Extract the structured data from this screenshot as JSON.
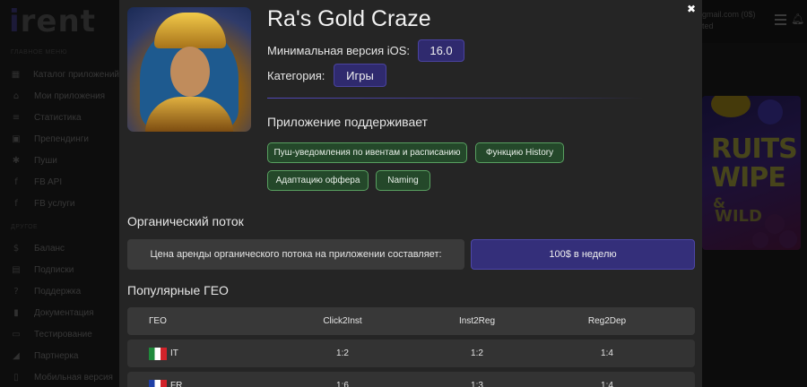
{
  "background": {
    "logo": {
      "accent": "i",
      "rest": "rent"
    },
    "menu_heading_main": "ГЛАВНОЕ МЕНЮ",
    "menu_heading_other": "ДРУГОЕ",
    "menu_items": [
      {
        "icon": "grid-icon",
        "label": "Каталог приложений"
      },
      {
        "icon": "home-icon",
        "label": "Мои приложения"
      },
      {
        "icon": "stats-icon",
        "label": "Статистика"
      },
      {
        "icon": "prepend-icon",
        "label": "Препендинги"
      },
      {
        "icon": "push-icon",
        "label": "Пуши"
      },
      {
        "icon": "facebook-icon",
        "label": "FB API"
      },
      {
        "icon": "facebook-icon",
        "label": "FB услуги"
      }
    ],
    "menu_items_other": [
      {
        "icon": "dollar-icon",
        "label": "Баланс"
      },
      {
        "icon": "subscription-icon",
        "label": "Подписки"
      },
      {
        "icon": "help-icon",
        "label": "Поддержка"
      },
      {
        "icon": "document-icon",
        "label": "Документация"
      },
      {
        "icon": "testing-icon",
        "label": "Тестирование"
      },
      {
        "icon": "partner-icon",
        "label": "Партнерка"
      },
      {
        "icon": "mobile-icon",
        "label": "Мобильная версия"
      }
    ],
    "user_email": "gmail.com (0$)",
    "user_sub": "ted",
    "promo": {
      "line1": "RUITS",
      "line2": "WIPE",
      "line3": "&",
      "line4": "WILD"
    }
  },
  "modal": {
    "app_title": "Ra's Gold Craze",
    "ios_label": "Минимальная версия iOS:",
    "ios_version": "16.0",
    "category_label": "Категория:",
    "category_value": "Игры",
    "supports_heading": "Приложение поддерживает",
    "features": [
      "Пуш-уведомления по ивентам и расписанию",
      "Функцию History",
      "Адаптацию оффера",
      "Naming"
    ],
    "organic_heading": "Органический поток",
    "organic_price_label": "Цена аренды органического потока на приложении составляет:",
    "organic_price_value": "100$ в неделю",
    "geo_heading": "Популярные ГЕО",
    "geo_table": {
      "columns": [
        "ГЕО",
        "Click2Inst",
        "Inst2Reg",
        "Reg2Dep"
      ],
      "rows": [
        {
          "flag": "italy-flag",
          "geo": "IT",
          "click2inst": "1:2",
          "inst2reg": "1:2",
          "reg2dep": "1:4"
        },
        {
          "flag": "france-flag",
          "geo": "FR",
          "click2inst": "1:6",
          "inst2reg": "1:3",
          "reg2dep": "1:4"
        }
      ]
    },
    "close_icon": "close-icon"
  },
  "colors": {
    "accent_purple": "#2f2a6e",
    "feature_green": "#24482a",
    "modal_bg": "#252525"
  }
}
